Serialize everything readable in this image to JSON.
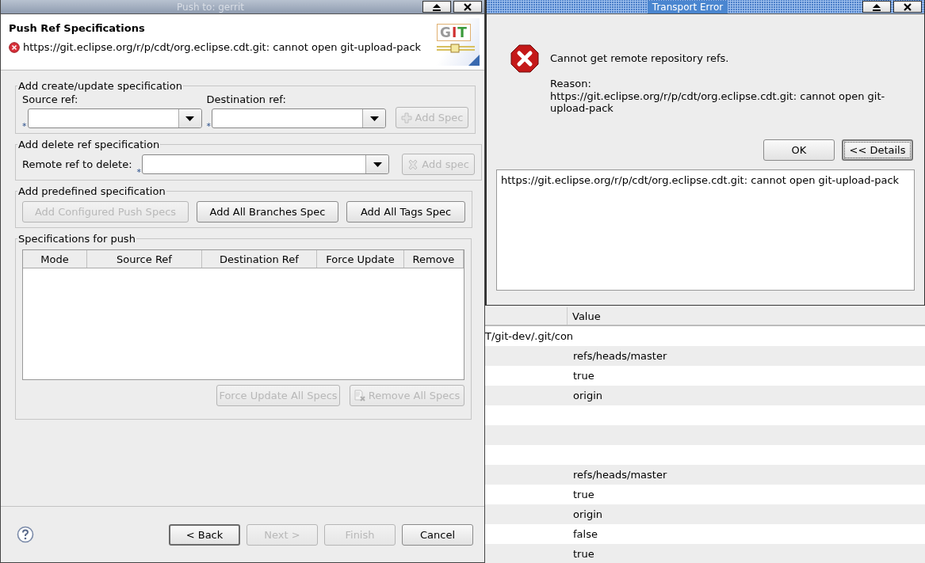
{
  "push_dialog": {
    "title": "Push to: gerrit",
    "header": {
      "heading": "Push Ref Specifications",
      "error_message": "https://git.eclipse.org/r/p/cdt/org.eclipse.cdt.git: cannot open git-upload-pack",
      "logo_text": "GIT"
    },
    "create_group": {
      "legend": "Add create/update specification",
      "source_label": "Source ref:",
      "destination_label": "Destination ref:",
      "required_mark_source": "*",
      "required_mark_destination": "*",
      "add_button": {
        "label": "Add Spec",
        "disabled": true
      }
    },
    "delete_group": {
      "legend": "Add delete ref specification",
      "remote_label": "Remote ref to delete:",
      "required_mark": "*",
      "add_button": {
        "label": "Add spec",
        "disabled": true
      }
    },
    "predefined_group": {
      "legend": "Add predefined specification",
      "buttons": [
        {
          "label": "Add Configured Push Specs",
          "disabled": true
        },
        {
          "label": "Add All Branches Spec",
          "disabled": false
        },
        {
          "label": "Add All Tags Spec",
          "disabled": false
        }
      ]
    },
    "specs_group": {
      "legend": "Specifications for push",
      "columns": [
        "Mode",
        "Source Ref",
        "Destination Ref",
        "Force Update",
        "Remove"
      ],
      "buttons": [
        {
          "kind": "plain",
          "label": "Force Update All Specs",
          "disabled": true
        },
        {
          "kind": "remove",
          "label": "Remove All Specs",
          "disabled": true
        }
      ]
    },
    "wizard_buttons": [
      {
        "label": "< Back",
        "disabled": false,
        "default": true
      },
      {
        "label": "Next >",
        "disabled": true,
        "default": false
      },
      {
        "label": "Finish",
        "disabled": true,
        "default": false
      },
      {
        "label": "Cancel",
        "disabled": false,
        "default": false
      }
    ]
  },
  "error_dialog": {
    "title": "Transport Error",
    "message": "Cannot get remote repository refs.",
    "reason_label": "Reason:",
    "reason": "https://git.eclipse.org/r/p/cdt/org.eclipse.cdt.git: cannot open git-upload-pack",
    "buttons": [
      {
        "label": "OK",
        "focused": false
      },
      {
        "label": "<< Details",
        "focused": true
      }
    ],
    "details": "https://git.eclipse.org/r/p/cdt/org.eclipse.cdt.git: cannot open git-upload-pack"
  },
  "background_table": {
    "value_header": "Value",
    "rows": [
      {
        "column_1": "T/git-dev/.git/con"
      },
      {
        "value": "refs/heads/master"
      },
      {
        "value": "true"
      },
      {
        "value": "origin"
      },
      {},
      {},
      {},
      {
        "value": "refs/heads/master"
      },
      {
        "value": "true"
      },
      {
        "value": "origin"
      },
      {
        "value": "false"
      },
      {
        "value": "true"
      }
    ]
  }
}
